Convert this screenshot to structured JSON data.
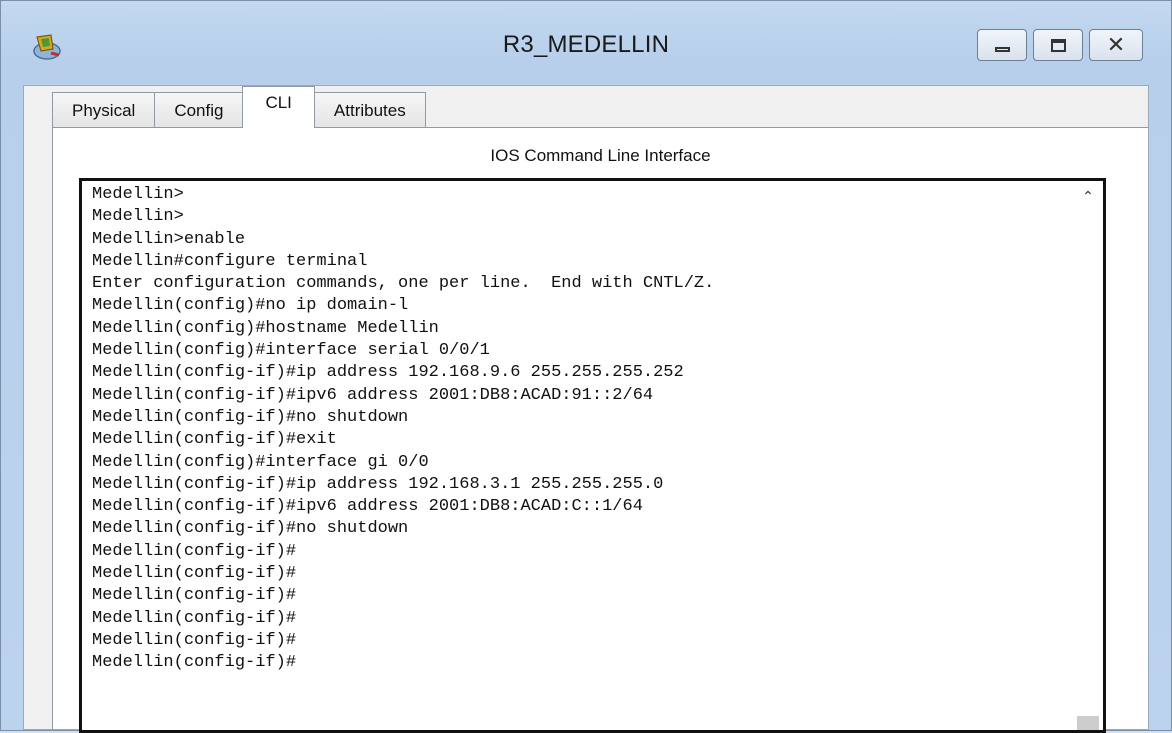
{
  "window": {
    "title": "R3_MEDELLIN",
    "icon": "packet-tracer-router-icon",
    "controls": {
      "minimize": "minimize-icon",
      "maximize": "maximize-icon",
      "close": "close-icon",
      "close_glyph": "✕"
    }
  },
  "tabs": [
    {
      "label": "Physical",
      "active": false
    },
    {
      "label": "Config",
      "active": false
    },
    {
      "label": "CLI",
      "active": true
    },
    {
      "label": "Attributes",
      "active": false
    }
  ],
  "cli": {
    "heading": "IOS Command Line Interface",
    "lines": [
      "Medellin>",
      "Medellin>",
      "Medellin>enable",
      "Medellin#configure terminal",
      "Enter configuration commands, one per line.  End with CNTL/Z.",
      "Medellin(config)#no ip domain-l",
      "Medellin(config)#hostname Medellin",
      "Medellin(config)#interface serial 0/0/1",
      "Medellin(config-if)#ip address 192.168.9.6 255.255.255.252",
      "Medellin(config-if)#ipv6 address 2001:DB8:ACAD:91::2/64",
      "Medellin(config-if)#no shutdown",
      "Medellin(config-if)#exit",
      "Medellin(config)#interface gi 0/0",
      "Medellin(config-if)#ip address 192.168.3.1 255.255.255.0",
      "Medellin(config-if)#ipv6 address 2001:DB8:ACAD:C::1/64",
      "Medellin(config-if)#no shutdown",
      "Medellin(config-if)#",
      "Medellin(config-if)#",
      "Medellin(config-if)#",
      "Medellin(config-if)#",
      "Medellin(config-if)#",
      "Medellin(config-if)#"
    ],
    "scroll_up_glyph": "⌃"
  }
}
